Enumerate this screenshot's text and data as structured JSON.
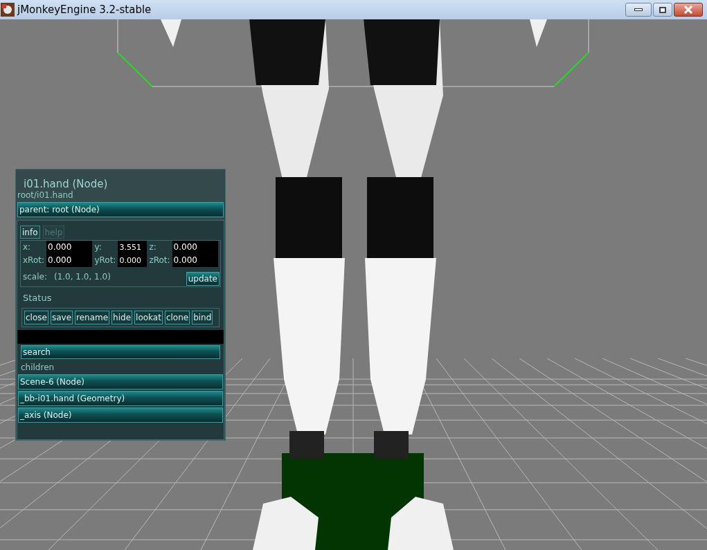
{
  "window": {
    "title": "jMonkeyEngine 3.2-stable"
  },
  "panel": {
    "title": "i01.hand (Node)",
    "path": "root/i01.hand",
    "parent": "parent: root (Node)",
    "tabs": [
      {
        "label": "info",
        "selected": true
      },
      {
        "label": "help",
        "selected": false
      }
    ],
    "fields": [
      {
        "label": "x:",
        "value": "0.000"
      },
      {
        "label": "y:",
        "value": "3.551"
      },
      {
        "label": "z:",
        "value": "0.000"
      },
      {
        "label": "xRot:",
        "value": "0.000"
      },
      {
        "label": "yRot:",
        "value": "0.000"
      },
      {
        "label": "zRot:",
        "value": "0.000"
      }
    ],
    "scale_label": "scale:",
    "scale_value": "(1.0, 1.0, 1.0)",
    "update": "update",
    "status": "Status",
    "buttons": [
      "close",
      "save",
      "rename",
      "hide",
      "lookat",
      "clone",
      "bind"
    ],
    "search": {
      "placeholder": "search"
    },
    "children_label": "children",
    "children": [
      "Scene-6 (Node)",
      "_bb-i01.hand (Geometry)",
      "_axis (Node)"
    ]
  }
}
